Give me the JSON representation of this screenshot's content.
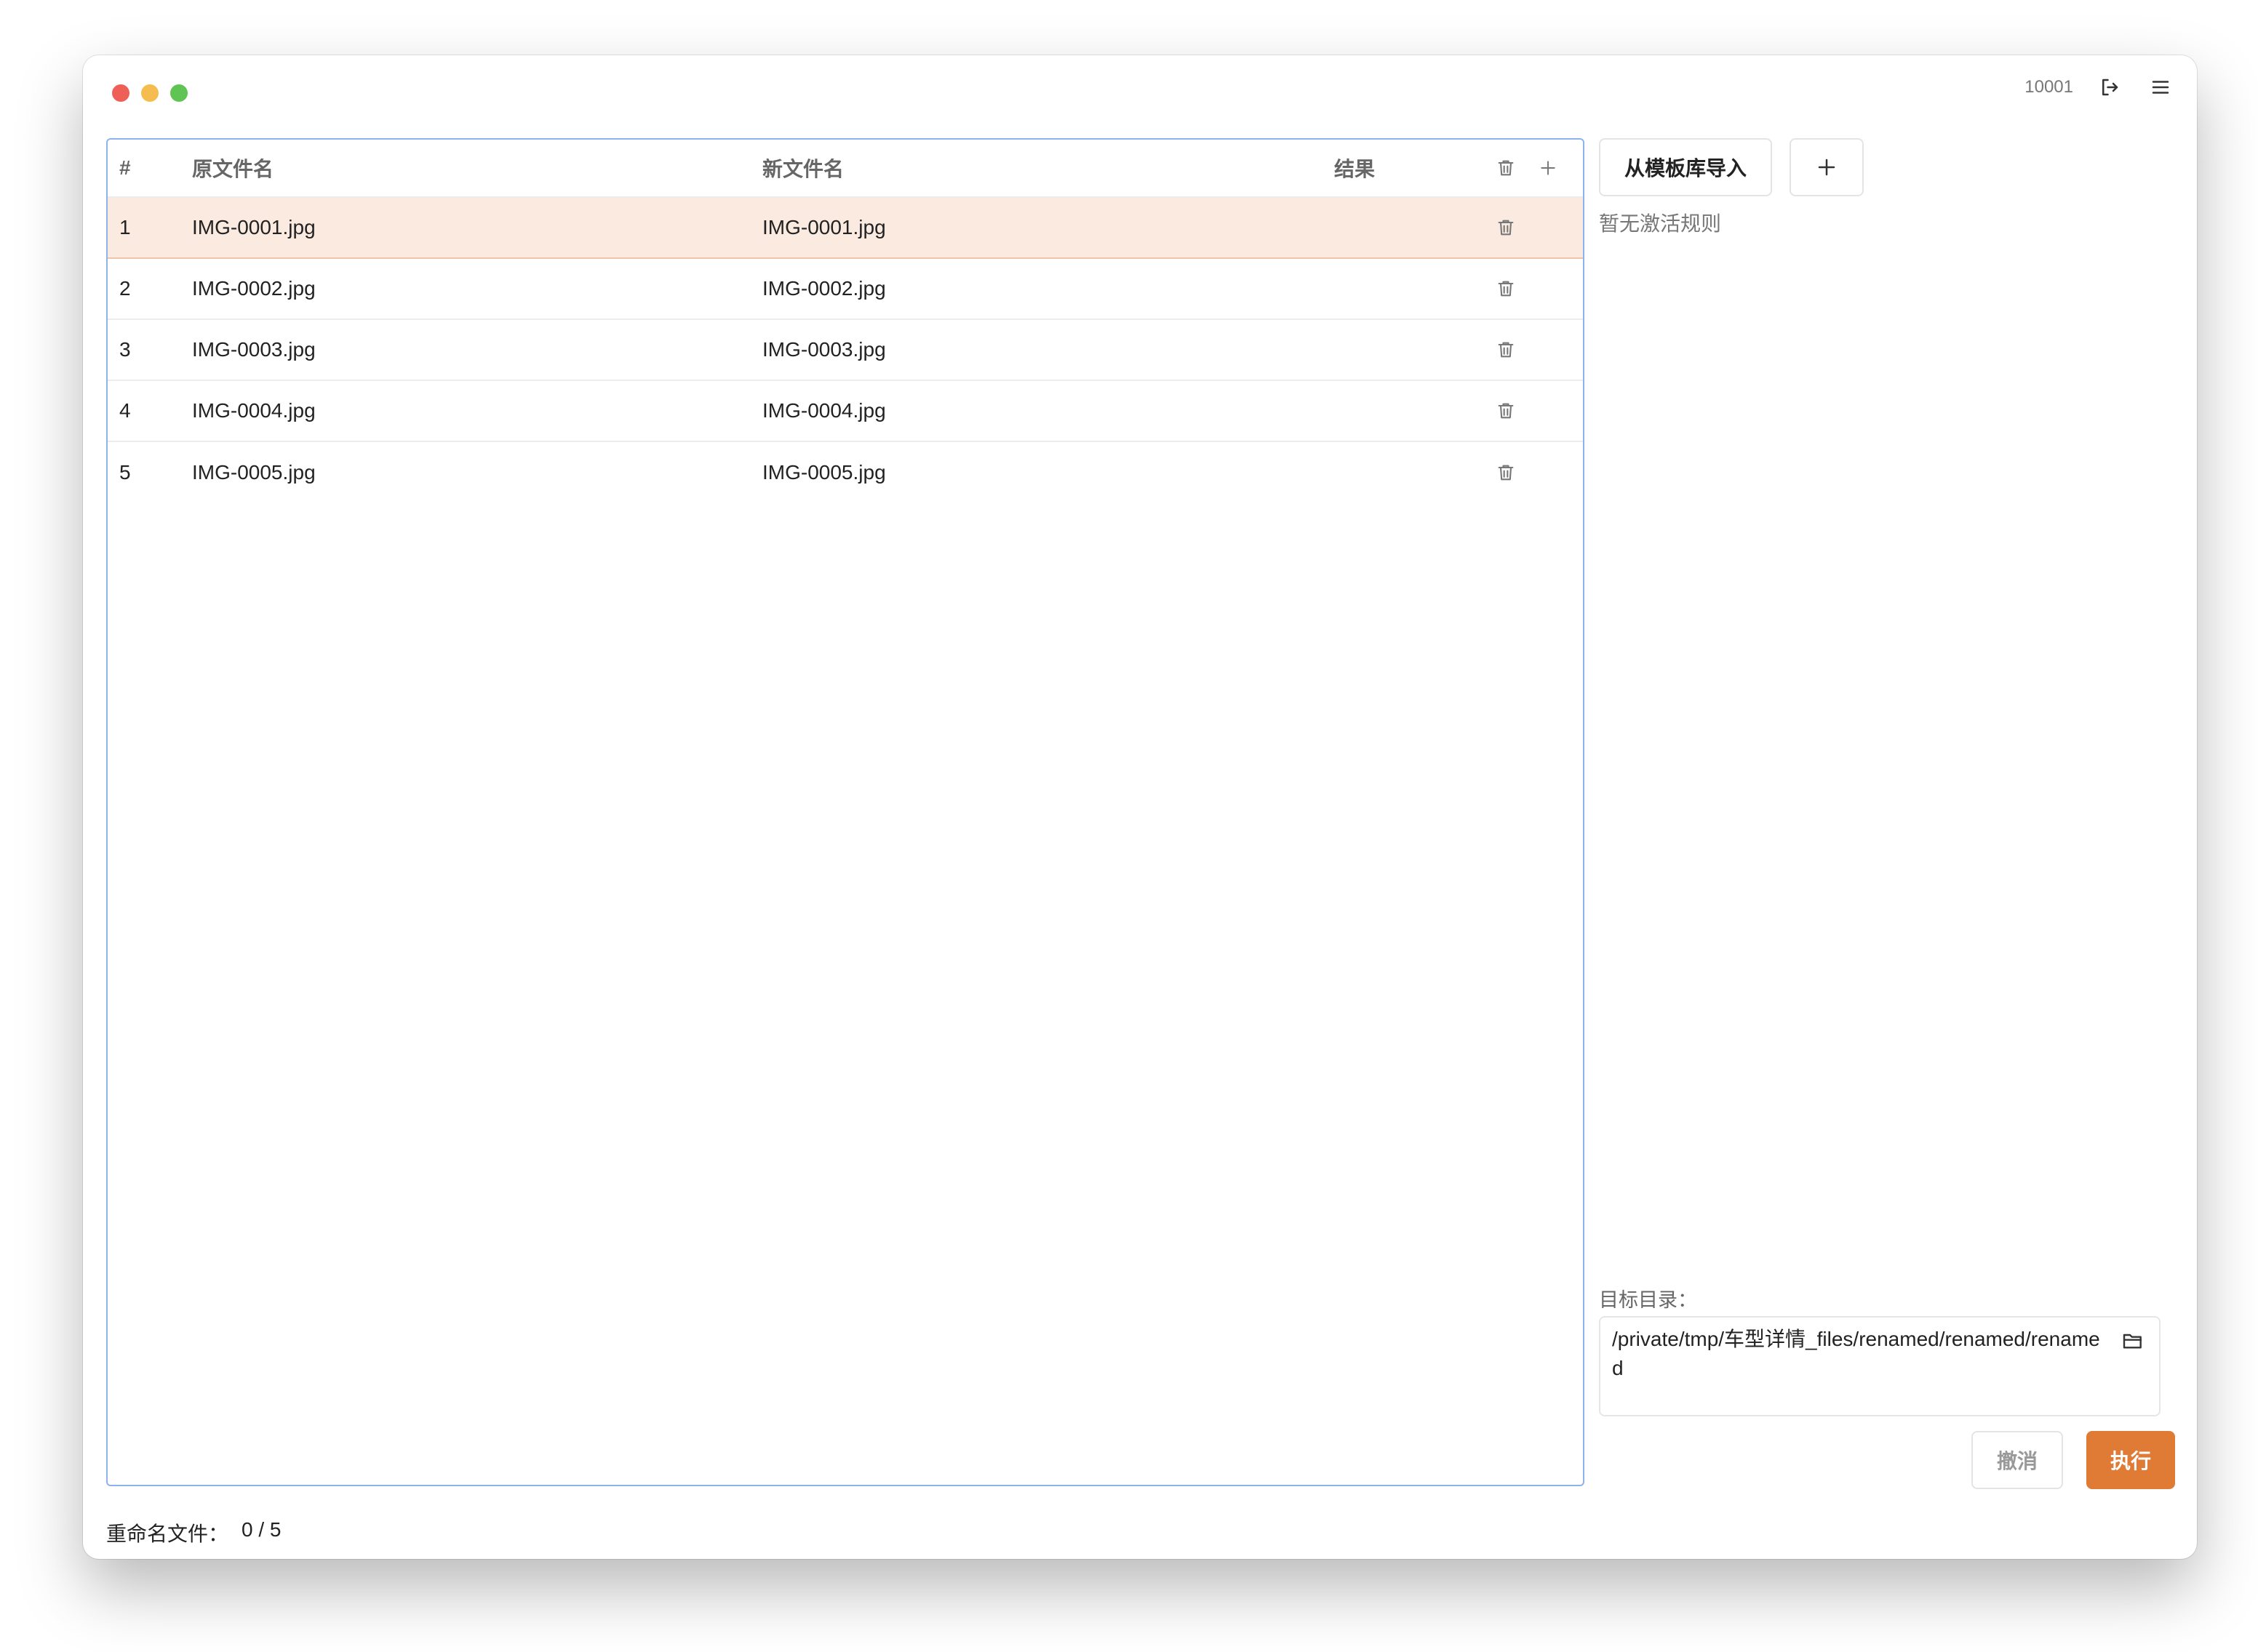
{
  "window": {
    "user_id": "10001"
  },
  "table": {
    "headers": {
      "index": "#",
      "original_name": "原文件名",
      "new_name": "新文件名",
      "result": "结果"
    },
    "rows": [
      {
        "index": "1",
        "original_name": "IMG-0001.jpg",
        "new_name": "IMG-0001.jpg",
        "result": "",
        "selected": true
      },
      {
        "index": "2",
        "original_name": "IMG-0002.jpg",
        "new_name": "IMG-0002.jpg",
        "result": ""
      },
      {
        "index": "3",
        "original_name": "IMG-0003.jpg",
        "new_name": "IMG-0003.jpg",
        "result": ""
      },
      {
        "index": "4",
        "original_name": "IMG-0004.jpg",
        "new_name": "IMG-0004.jpg",
        "result": ""
      },
      {
        "index": "5",
        "original_name": "IMG-0005.jpg",
        "new_name": "IMG-0005.jpg",
        "result": ""
      }
    ]
  },
  "rules": {
    "import_label": "从模板库导入",
    "add_icon": "plus-icon",
    "empty_text": "暂无激活规则"
  },
  "target": {
    "label": "目标目录：",
    "path": "/private/tmp/车型详情_files/renamed/renamed/renamed"
  },
  "actions": {
    "cancel_label": "撤消",
    "execute_label": "执行"
  },
  "status": {
    "label": "重命名文件：",
    "count": "0 / 5"
  },
  "colors": {
    "accent": "#e07b35",
    "selected_row": "#fbeae0",
    "panel_border": "#8eb3ec",
    "traffic_red": "#ed5f57",
    "traffic_yellow": "#f5bd4f",
    "traffic_green": "#5fc454"
  }
}
